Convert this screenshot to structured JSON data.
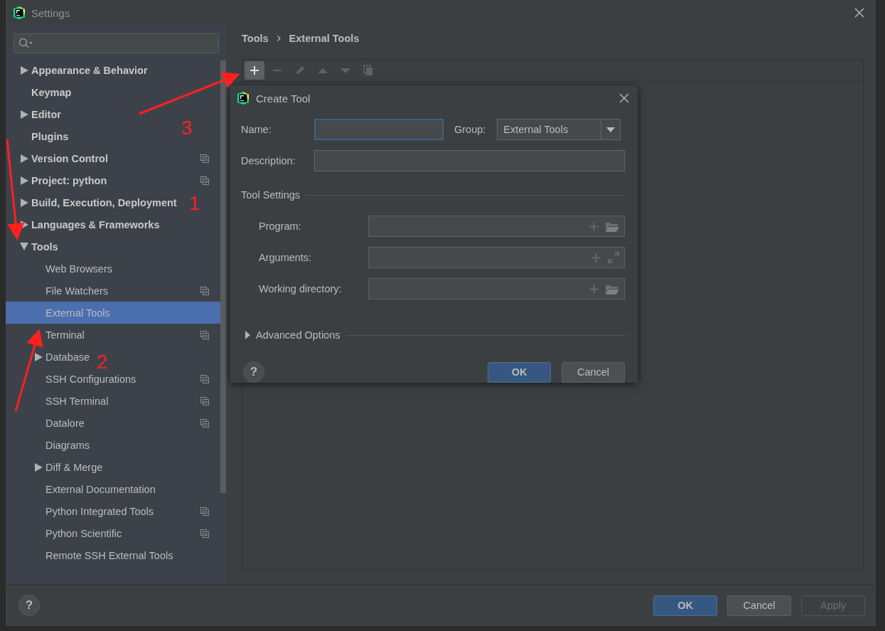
{
  "window": {
    "title": "Settings"
  },
  "sidebar": {
    "items": [
      {
        "label": "Appearance & Behavior",
        "expanded": false,
        "selected": false,
        "project_level": false
      },
      {
        "label": "Keymap",
        "selected": false,
        "project_level": false
      },
      {
        "label": "Editor",
        "expanded": false,
        "selected": false,
        "project_level": false
      },
      {
        "label": "Plugins",
        "selected": false,
        "project_level": false
      },
      {
        "label": "Version Control",
        "expanded": false,
        "selected": false,
        "project_level": true
      },
      {
        "label": "Project: python",
        "expanded": false,
        "selected": false,
        "project_level": true
      },
      {
        "label": "Build, Execution, Deployment",
        "expanded": false,
        "selected": false,
        "project_level": false
      },
      {
        "label": "Languages & Frameworks",
        "expanded": false,
        "selected": false,
        "project_level": false
      },
      {
        "label": "Tools",
        "expanded": true,
        "selected": false,
        "project_level": false,
        "children": [
          {
            "label": "Web Browsers",
            "selected": false,
            "project_level": false
          },
          {
            "label": "File Watchers",
            "selected": false,
            "project_level": true
          },
          {
            "label": "External Tools",
            "selected": true,
            "project_level": false
          },
          {
            "label": "Terminal",
            "selected": false,
            "project_level": true
          },
          {
            "label": "Database",
            "expanded": false,
            "selected": false,
            "project_level": false
          },
          {
            "label": "SSH Configurations",
            "selected": false,
            "project_level": true
          },
          {
            "label": "SSH Terminal",
            "selected": false,
            "project_level": true
          },
          {
            "label": "Datalore",
            "selected": false,
            "project_level": true
          },
          {
            "label": "Diagrams",
            "selected": false,
            "project_level": false
          },
          {
            "label": "Diff & Merge",
            "expanded": false,
            "selected": false,
            "project_level": false
          },
          {
            "label": "External Documentation",
            "selected": false,
            "project_level": false
          },
          {
            "label": "Python Integrated Tools",
            "selected": false,
            "project_level": true
          },
          {
            "label": "Python Scientific",
            "selected": false,
            "project_level": true
          },
          {
            "label": "Remote SSH External Tools",
            "selected": false,
            "project_level": false
          }
        ]
      }
    ]
  },
  "breadcrumb": [
    "Tools",
    "External Tools"
  ],
  "toolbar": [
    {
      "kind": "add",
      "disabled": false,
      "hovered": true
    },
    {
      "kind": "remove",
      "disabled": true,
      "hovered": false
    },
    {
      "kind": "edit",
      "disabled": true,
      "hovered": false
    },
    {
      "kind": "up",
      "disabled": true,
      "hovered": false
    },
    {
      "kind": "down",
      "disabled": true,
      "hovered": false
    },
    {
      "kind": "copy",
      "disabled": true,
      "hovered": false
    }
  ],
  "dialog": {
    "title": "Create Tool",
    "name": {
      "label": "Name:",
      "focused": true
    },
    "group": {
      "label": "Group:",
      "value": "External Tools"
    },
    "description": {
      "label": "Description:"
    },
    "section": "Tool Settings",
    "fields": [
      {
        "label": "Program:",
        "kind": "browse"
      },
      {
        "label": "Arguments:",
        "kind": "expand"
      },
      {
        "label": "Working directory:",
        "kind": "browse"
      }
    ],
    "advanced": {
      "label": "Advanced Options",
      "expanded": false
    },
    "help": "?",
    "buttons": [
      {
        "label": "OK",
        "default": true
      },
      {
        "label": "Cancel",
        "default": false
      }
    ]
  },
  "help": "?",
  "buttons": [
    {
      "label": "OK",
      "default": true,
      "disabled": false
    },
    {
      "label": "Cancel",
      "default": false,
      "disabled": false
    },
    {
      "label": "Apply",
      "default": false,
      "disabled": true
    }
  ],
  "annotations": [
    "1",
    "2",
    "3"
  ]
}
